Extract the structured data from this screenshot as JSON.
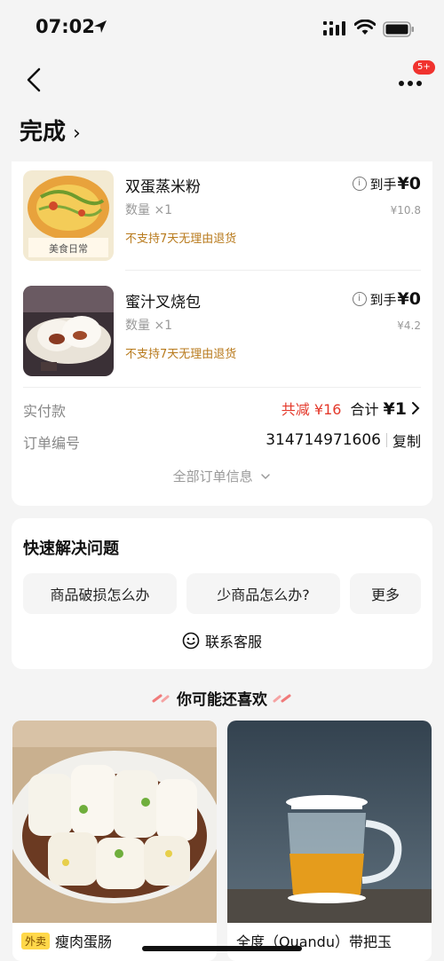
{
  "status_bar": {
    "time": "07:02"
  },
  "nav": {
    "badge": "5+"
  },
  "order_status": {
    "title": "完成",
    "chevron": "›"
  },
  "items": [
    {
      "name": "双蛋蒸米粉",
      "qty": "数量 ×1",
      "note": "不支持7天无理由退货",
      "price_prefix": "到手",
      "price": "¥0",
      "original_price": "¥10.8",
      "thumb_text": "美食日常"
    },
    {
      "name": "蜜汁叉烧包",
      "qty": "数量 ×1",
      "note": "不支持7天无理由退货",
      "price_prefix": "到手",
      "price": "¥0",
      "original_price": "¥4.2"
    }
  ],
  "payment": {
    "label": "实付款",
    "discount": "共减 ¥16",
    "total_prefix": "合计",
    "total": "¥1"
  },
  "order_number": {
    "label": "订单编号",
    "value": "314714971606",
    "copy": "复制"
  },
  "all_info": "全部订单信息",
  "help": {
    "title": "快速解决问题",
    "buttons": [
      "商品破损怎么办",
      "少商品怎么办?",
      "更多"
    ],
    "contact": "联系客服"
  },
  "recommend": {
    "title": "你可能还喜欢",
    "products": [
      {
        "tag": "外卖",
        "name": "瘦肉蛋肠"
      },
      {
        "name": "全度（Quandu）带把玉"
      }
    ]
  },
  "colors": {
    "accent_red": "#e4392b",
    "note_orange": "#b87a1c",
    "badge_red": "#f0322e"
  }
}
